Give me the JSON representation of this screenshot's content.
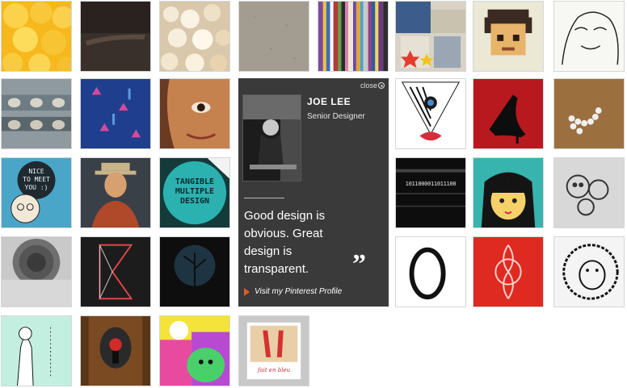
{
  "profile": {
    "close_label": "close",
    "name": "JOE LEE",
    "title": "Senior Designer",
    "quote": "Good design is obvious. Great design is transparent.",
    "quote_mark": "”",
    "link_label": "Visit my Pinterest Profile"
  },
  "tile_text": {
    "nice": "NICE\nTO MEET\nYOU :)",
    "tangible": "TANGIBLE\nMULTIPLE\nDESIGN",
    "binary": "1011000011011100",
    "signature": "fait en bleu"
  },
  "colors": {
    "card_bg": "#3a3a3a",
    "link_arrow": "#e05a2b"
  }
}
